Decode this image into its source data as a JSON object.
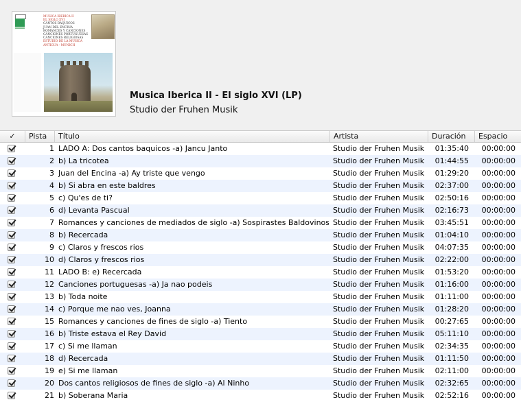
{
  "album": {
    "title": "Musica Iberica II - El siglo XVI (LP)",
    "artist": "Studio der Fruhen Musik",
    "cover_lines": [
      "MUSICA IBERICA II",
      "EL SIGLO XVI",
      "CANTOS BAQUICOS",
      "JUAN DEL ENCINA",
      "ROMANCES Y CANCIONES",
      "CANCIONES PORTUGUESAS",
      "CANCIONES RELIGIOSAS",
      "ESTUDIO DE LA MUSICA ANTIGUA - MUNICH"
    ]
  },
  "columns": {
    "check": "✓",
    "track": "Pista",
    "title": "Título",
    "artist": "Artista",
    "duration": "Duración",
    "space": "Espacio"
  },
  "tracks": [
    {
      "num": "1",
      "title": "LADO A: Dos cantos baquicos -a) Jancu Janto",
      "artist": "Studio der Fruhen Musik",
      "duration": "01:35:40",
      "space": "00:00:00"
    },
    {
      "num": "2",
      "title": "b) La tricotea",
      "artist": "Studio der Fruhen Musik",
      "duration": "01:44:55",
      "space": "00:00:00"
    },
    {
      "num": "3",
      "title": "Juan del Encina -a) Ay triste que vengo",
      "artist": "Studio der Fruhen Musik",
      "duration": "01:29:20",
      "space": "00:00:00"
    },
    {
      "num": "4",
      "title": "b) Si abra en este baldres",
      "artist": "Studio der Fruhen Musik",
      "duration": "02:37:00",
      "space": "00:00:00"
    },
    {
      "num": "5",
      "title": "c) Qu'es de ti?",
      "artist": "Studio der Fruhen Musik",
      "duration": "02:50:16",
      "space": "00:00:00"
    },
    {
      "num": "6",
      "title": "d) Levanta Pascual",
      "artist": "Studio der Fruhen Musik",
      "duration": "02:16:73",
      "space": "00:00:00"
    },
    {
      "num": "7",
      "title": "Romances y canciones de mediados de siglo -a) Sospirastes Baldovinos",
      "artist": "Studio der Fruhen Musik",
      "duration": "03:45:51",
      "space": "00:00:00"
    },
    {
      "num": "8",
      "title": "b) Recercada",
      "artist": "Studio der Fruhen Musik",
      "duration": "01:04:10",
      "space": "00:00:00"
    },
    {
      "num": "9",
      "title": "c) Claros y frescos rios",
      "artist": "Studio der Fruhen Musik",
      "duration": "04:07:35",
      "space": "00:00:00"
    },
    {
      "num": "10",
      "title": "d) Claros y frescos rios",
      "artist": "Studio der Fruhen Musik",
      "duration": "02:22:00",
      "space": "00:00:00"
    },
    {
      "num": "11",
      "title": "LADO B: e) Recercada",
      "artist": "Studio der Fruhen Musik",
      "duration": "01:53:20",
      "space": "00:00:00"
    },
    {
      "num": "12",
      "title": "Canciones portuguesas -a) Ja nao podeis",
      "artist": "Studio der Fruhen Musik",
      "duration": "01:16:00",
      "space": "00:00:00"
    },
    {
      "num": "13",
      "title": "b) Toda noite",
      "artist": "Studio der Fruhen Musik",
      "duration": "01:11:00",
      "space": "00:00:00"
    },
    {
      "num": "14",
      "title": "c) Porque me nao ves, Joanna",
      "artist": "Studio der Fruhen Musik",
      "duration": "01:28:20",
      "space": "00:00:00"
    },
    {
      "num": "15",
      "title": "Romances y canciones de fines de siglo -a) Tiento",
      "artist": "Studio der Fruhen Musik",
      "duration": "00:27:65",
      "space": "00:00:00"
    },
    {
      "num": "16",
      "title": "b) Triste estava el Rey David",
      "artist": "Studio der Fruhen Musik",
      "duration": "05:11:10",
      "space": "00:00:00"
    },
    {
      "num": "17",
      "title": "c) Si me llaman",
      "artist": "Studio der Fruhen Musik",
      "duration": "02:34:35",
      "space": "00:00:00"
    },
    {
      "num": "18",
      "title": "d) Recercada",
      "artist": "Studio der Fruhen Musik",
      "duration": "01:11:50",
      "space": "00:00:00"
    },
    {
      "num": "19",
      "title": "e) Si me llaman",
      "artist": "Studio der Fruhen Musik",
      "duration": "02:11:00",
      "space": "00:00:00"
    },
    {
      "num": "20",
      "title": "Dos cantos religiosos de fines de siglo -a) Al Ninho",
      "artist": "Studio der Fruhen Musik",
      "duration": "02:32:65",
      "space": "00:00:00"
    },
    {
      "num": "21",
      "title": "b) Soberana Maria",
      "artist": "Studio der Fruhen Musik",
      "duration": "02:52:16",
      "space": "00:00:00"
    }
  ]
}
